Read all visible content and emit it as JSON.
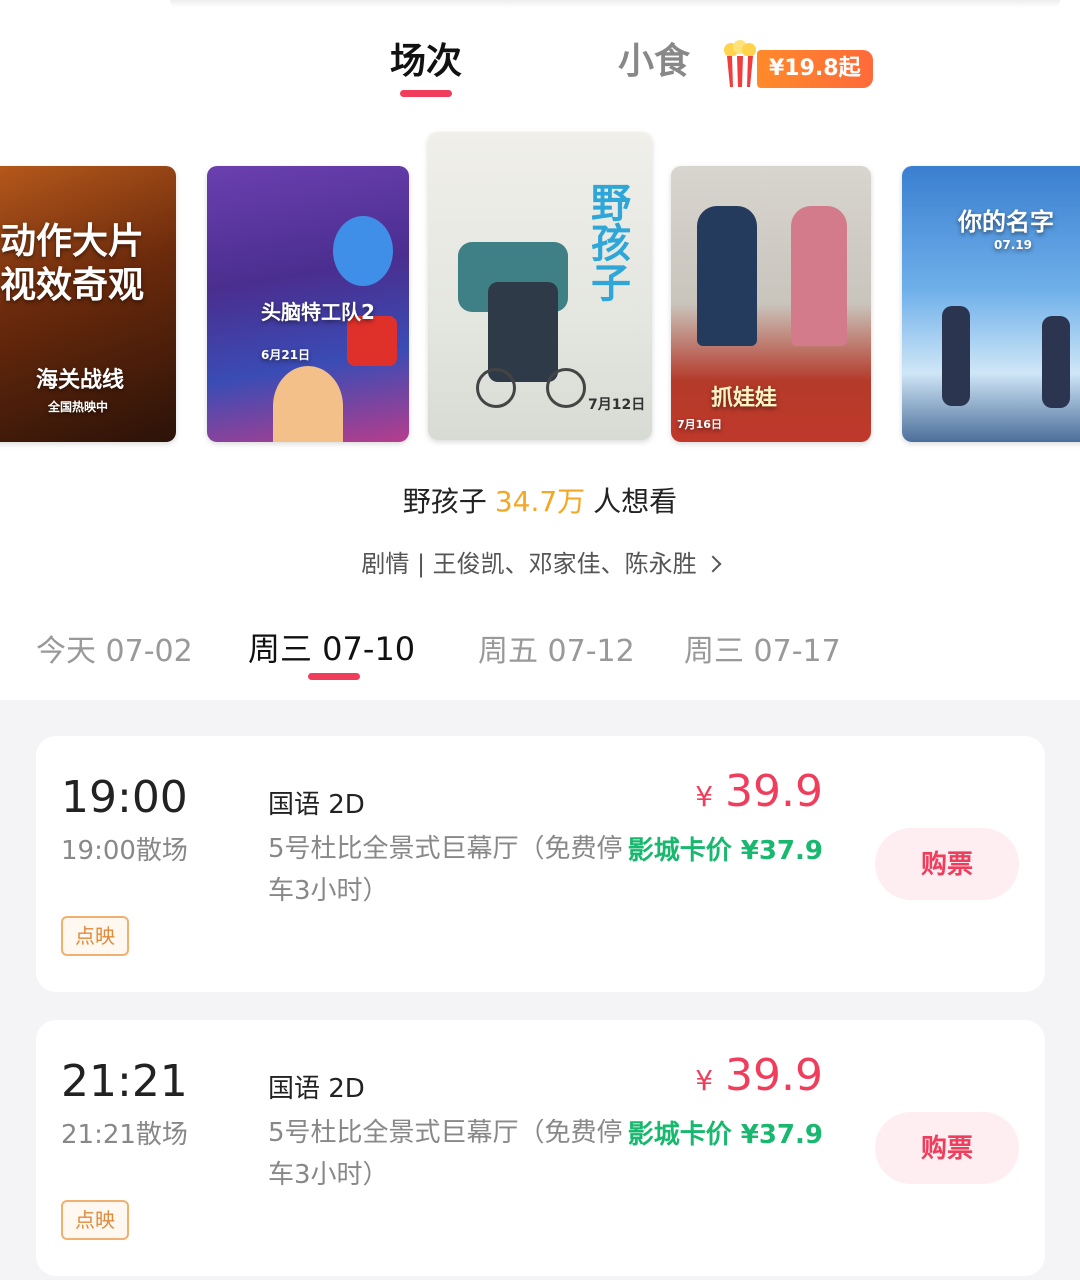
{
  "tabs": {
    "sessions": "场次",
    "snacks": "小食",
    "snack_badge": "¥19.8起"
  },
  "posters": [
    {
      "title": "海关战线",
      "line1": "动作大片",
      "line2": "视效奇观",
      "sub": "全国热映中"
    },
    {
      "title": "头脑特工队2",
      "date": "6月21日"
    },
    {
      "title": "野孩子",
      "date": "7月12日"
    },
    {
      "title": "抓娃娃",
      "date": "7月16日"
    },
    {
      "title": "你的名字",
      "date": "07.19"
    }
  ],
  "movie": {
    "name": "野孩子",
    "want_count": "34.7万",
    "want_suffix": "人想看",
    "meta": "剧情 | 王俊凯、邓家佳、陈永胜"
  },
  "dates": [
    {
      "label": "今天 07-02"
    },
    {
      "label": "周三 07-10"
    },
    {
      "label": "周五 07-12"
    },
    {
      "label": "周三 07-17"
    }
  ],
  "showtimes": [
    {
      "start": "19:00",
      "end": "19:00散场",
      "tag": "点映",
      "lang": "国语 2D",
      "hall": "5号杜比全景式巨幕厅（免费停车3小时）",
      "yen": "¥",
      "price": "39.9",
      "member_price": "影城卡价 ¥37.9",
      "buy": "购票"
    },
    {
      "start": "21:21",
      "end": "21:21散场",
      "tag": "点映",
      "lang": "国语 2D",
      "hall": "5号杜比全景式巨幕厅（免费停车3小时）",
      "yen": "¥",
      "price": "39.9",
      "member_price": "影城卡价 ¥37.9",
      "buy": "购票"
    }
  ],
  "colors": {
    "accent": "#f03d5c",
    "want": "#f5a623",
    "member": "#19b86f"
  }
}
